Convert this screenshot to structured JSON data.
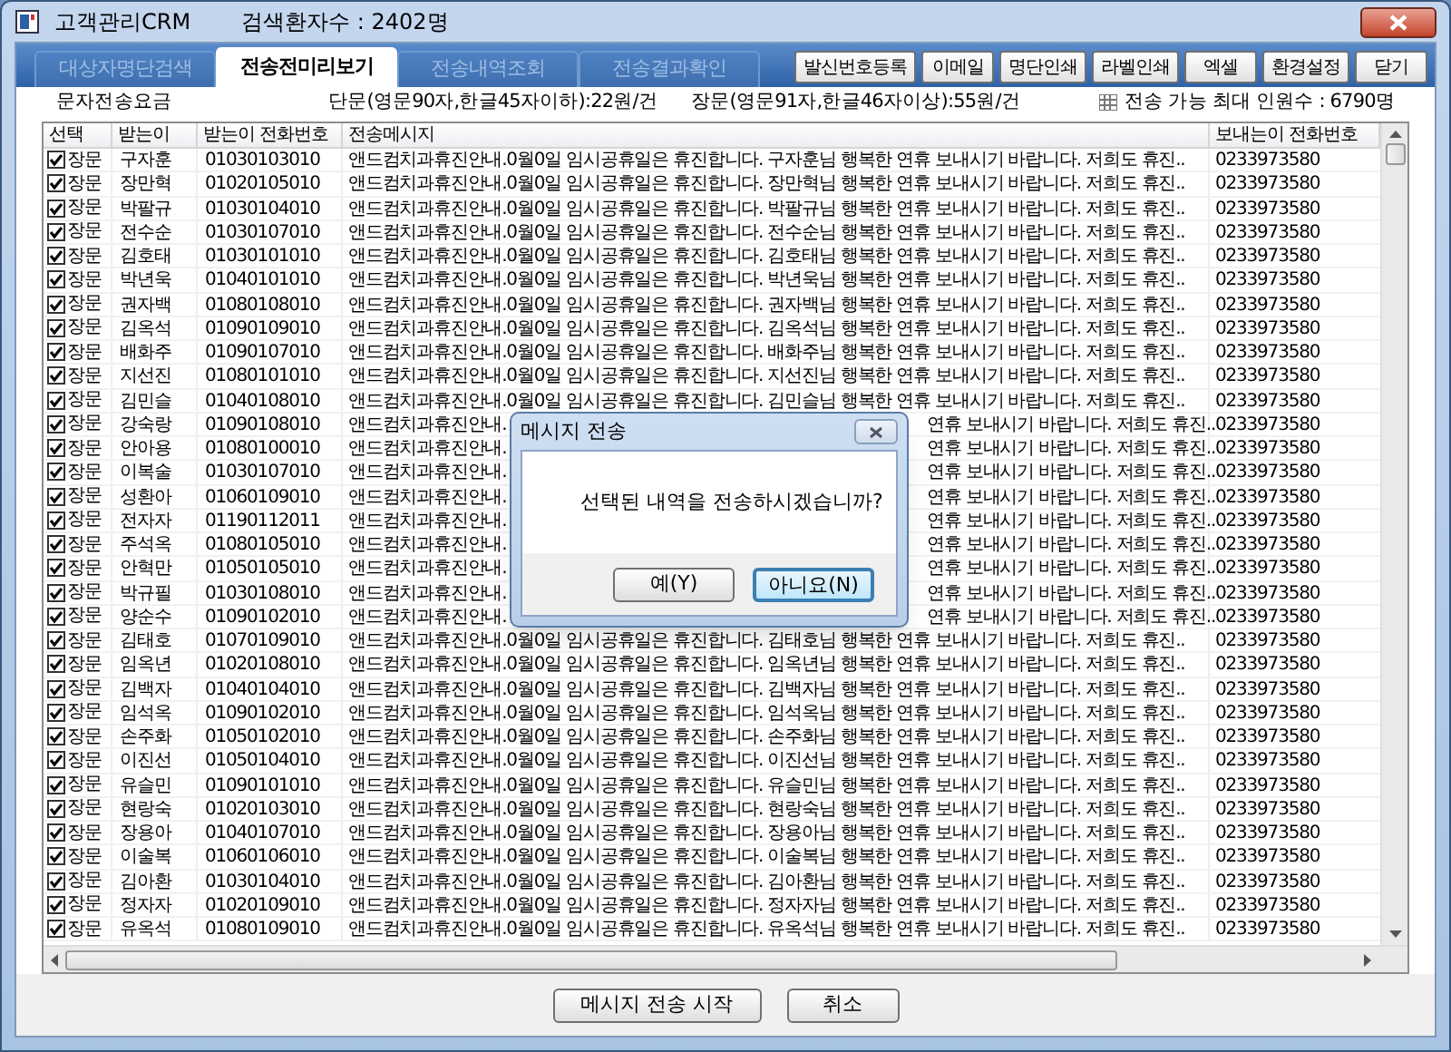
{
  "window": {
    "title": "고객관리CRM",
    "patient_count": "검색환자수 : 2402명"
  },
  "tabs": [
    {
      "label": "대상자명단검색",
      "selected": false
    },
    {
      "label": "전송전미리보기",
      "selected": true
    },
    {
      "label": "전송내역조회",
      "selected": false
    },
    {
      "label": "전송결과확인",
      "selected": false
    }
  ],
  "toolbar": [
    "발신번호등록",
    "이메일",
    "명단인쇄",
    "라벨인쇄",
    "엑셀",
    "환경설정",
    "닫기"
  ],
  "fee_info": {
    "label": "문자전송요금",
    "short": "단문(영문90자,한글45자이하):22원/건",
    "long": "장문(영문91자,한글46자이상):55원/건",
    "max_recipients": "전송 가능 최대 인원수 : 6790명"
  },
  "table": {
    "columns": [
      "선택",
      "받는이",
      "받는이 전화번호",
      "전송메시지",
      "보내는이 전화번호"
    ],
    "rows": [
      {
        "checked": true,
        "type": "장문",
        "name": "구자훈",
        "phone": "01030103010",
        "message": "앤드컴치과휴진안내.0월0일 임시공휴일은 휴진합니다. 구자훈님 행복한 연휴 보내시기 바랍니다. 저희도 휴진..",
        "sender": "0233973580"
      },
      {
        "checked": true,
        "type": "장문",
        "name": "장만혁",
        "phone": "01020105010",
        "message": "앤드컴치과휴진안내.0월0일 임시공휴일은 휴진합니다. 장만혁님 행복한 연휴 보내시기 바랍니다. 저희도 휴진..",
        "sender": "0233973580"
      },
      {
        "checked": true,
        "type": "장문",
        "name": "박팔규",
        "phone": "01030104010",
        "message": "앤드컴치과휴진안내.0월0일 임시공휴일은 휴진합니다. 박팔규님 행복한 연휴 보내시기 바랍니다. 저희도 휴진..",
        "sender": "0233973580"
      },
      {
        "checked": true,
        "type": "장문",
        "name": "전수순",
        "phone": "01030107010",
        "message": "앤드컴치과휴진안내.0월0일 임시공휴일은 휴진합니다. 전수순님 행복한 연휴 보내시기 바랍니다. 저희도 휴진..",
        "sender": "0233973580"
      },
      {
        "checked": true,
        "type": "장문",
        "name": "김호태",
        "phone": "01030101010",
        "message": "앤드컴치과휴진안내.0월0일 임시공휴일은 휴진합니다. 김호태님 행복한 연휴 보내시기 바랍니다. 저희도 휴진..",
        "sender": "0233973580"
      },
      {
        "checked": true,
        "type": "장문",
        "name": "박년욱",
        "phone": "01040101010",
        "message": "앤드컴치과휴진안내.0월0일 임시공휴일은 휴진합니다. 박년욱님 행복한 연휴 보내시기 바랍니다. 저희도 휴진..",
        "sender": "0233973580"
      },
      {
        "checked": true,
        "type": "장문",
        "name": "권자백",
        "phone": "01080108010",
        "message": "앤드컴치과휴진안내.0월0일 임시공휴일은 휴진합니다. 권자백님 행복한 연휴 보내시기 바랍니다. 저희도 휴진..",
        "sender": "0233973580"
      },
      {
        "checked": true,
        "type": "장문",
        "name": "김옥석",
        "phone": "01090109010",
        "message": "앤드컴치과휴진안내.0월0일 임시공휴일은 휴진합니다. 김옥석님 행복한 연휴 보내시기 바랍니다. 저희도 휴진..",
        "sender": "0233973580"
      },
      {
        "checked": true,
        "type": "장문",
        "name": "배화주",
        "phone": "01090107010",
        "message": "앤드컴치과휴진안내.0월0일 임시공휴일은 휴진합니다. 배화주님 행복한 연휴 보내시기 바랍니다. 저희도 휴진..",
        "sender": "0233973580"
      },
      {
        "checked": true,
        "type": "장문",
        "name": "지선진",
        "phone": "01080101010",
        "message": "앤드컴치과휴진안내.0월0일 임시공휴일은 휴진합니다. 지선진님 행복한 연휴 보내시기 바랍니다. 저희도 휴진..",
        "sender": "0233973580"
      },
      {
        "checked": true,
        "type": "장문",
        "name": "김민슬",
        "phone": "01040108010",
        "message": "앤드컴치과휴진안내.0월0일 임시공휴일은 휴진합니다. 김민슬님 행복한 연휴 보내시기 바랍니다. 저희도 휴진..",
        "sender": "0233973580"
      },
      {
        "checked": true,
        "type": "장문",
        "name": "강숙랑",
        "phone": "01090108010",
        "message": "앤드컴치과휴진안내.",
        "message_tail": "연휴 보내시기 바랍니다. 저희도 휴진..",
        "sender": "0233973580"
      },
      {
        "checked": true,
        "type": "장문",
        "name": "안아용",
        "phone": "01080100010",
        "message": "앤드컴치과휴진안내.",
        "message_tail": "연휴 보내시기 바랍니다. 저희도 휴진..",
        "sender": "0233973580"
      },
      {
        "checked": true,
        "type": "장문",
        "name": "이복술",
        "phone": "01030107010",
        "message": "앤드컴치과휴진안내.",
        "message_tail": "연휴 보내시기 바랍니다. 저희도 휴진..",
        "sender": "0233973580"
      },
      {
        "checked": true,
        "type": "장문",
        "name": "성환아",
        "phone": "01060109010",
        "message": "앤드컴치과휴진안내.",
        "message_tail": "연휴 보내시기 바랍니다. 저희도 휴진..",
        "sender": "0233973580"
      },
      {
        "checked": true,
        "type": "장문",
        "name": "전자자",
        "phone": "01190112011",
        "message": "앤드컴치과휴진안내.",
        "message_tail": "연휴 보내시기 바랍니다. 저희도 휴진..",
        "sender": "0233973580"
      },
      {
        "checked": true,
        "type": "장문",
        "name": "주석옥",
        "phone": "01080105010",
        "message": "앤드컴치과휴진안내.",
        "message_tail": "연휴 보내시기 바랍니다. 저희도 휴진..",
        "sender": "0233973580"
      },
      {
        "checked": true,
        "type": "장문",
        "name": "안혁만",
        "phone": "01050105010",
        "message": "앤드컴치과휴진안내.",
        "message_tail": "연휴 보내시기 바랍니다. 저희도 휴진..",
        "sender": "0233973580"
      },
      {
        "checked": true,
        "type": "장문",
        "name": "박규필",
        "phone": "01030108010",
        "message": "앤드컴치과휴진안내.",
        "message_tail": "연휴 보내시기 바랍니다. 저희도 휴진..",
        "sender": "0233973580"
      },
      {
        "checked": true,
        "type": "장문",
        "name": "양순수",
        "phone": "01090102010",
        "message": "앤드컴치과휴진안내.",
        "message_tail": "연휴 보내시기 바랍니다. 저희도 휴진..",
        "sender": "0233973580"
      },
      {
        "checked": true,
        "type": "장문",
        "name": "김태호",
        "phone": "01070109010",
        "message": "앤드컴치과휴진안내.0월0일 임시공휴일은 휴진합니다. 김태호님 행복한 연휴 보내시기 바랍니다. 저희도 휴진..",
        "sender": "0233973580"
      },
      {
        "checked": true,
        "type": "장문",
        "name": "임옥년",
        "phone": "01020108010",
        "message": "앤드컴치과휴진안내.0월0일 임시공휴일은 휴진합니다. 임옥년님 행복한 연휴 보내시기 바랍니다. 저희도 휴진..",
        "sender": "0233973580"
      },
      {
        "checked": true,
        "type": "장문",
        "name": "김백자",
        "phone": "01040104010",
        "message": "앤드컴치과휴진안내.0월0일 임시공휴일은 휴진합니다. 김백자님 행복한 연휴 보내시기 바랍니다. 저희도 휴진..",
        "sender": "0233973580"
      },
      {
        "checked": true,
        "type": "장문",
        "name": "임석옥",
        "phone": "01090102010",
        "message": "앤드컴치과휴진안내.0월0일 임시공휴일은 휴진합니다. 임석옥님 행복한 연휴 보내시기 바랍니다. 저희도 휴진..",
        "sender": "0233973580"
      },
      {
        "checked": true,
        "type": "장문",
        "name": "손주화",
        "phone": "01050102010",
        "message": "앤드컴치과휴진안내.0월0일 임시공휴일은 휴진합니다. 손주화님 행복한 연휴 보내시기 바랍니다. 저희도 휴진..",
        "sender": "0233973580"
      },
      {
        "checked": true,
        "type": "장문",
        "name": "이진선",
        "phone": "01050104010",
        "message": "앤드컴치과휴진안내.0월0일 임시공휴일은 휴진합니다. 이진선님 행복한 연휴 보내시기 바랍니다. 저희도 휴진..",
        "sender": "0233973580"
      },
      {
        "checked": true,
        "type": "장문",
        "name": "유슬민",
        "phone": "01090101010",
        "message": "앤드컴치과휴진안내.0월0일 임시공휴일은 휴진합니다. 유슬민님 행복한 연휴 보내시기 바랍니다. 저희도 휴진..",
        "sender": "0233973580"
      },
      {
        "checked": true,
        "type": "장문",
        "name": "현랑숙",
        "phone": "01020103010",
        "message": "앤드컴치과휴진안내.0월0일 임시공휴일은 휴진합니다. 현랑숙님 행복한 연휴 보내시기 바랍니다. 저희도 휴진..",
        "sender": "0233973580"
      },
      {
        "checked": true,
        "type": "장문",
        "name": "장용아",
        "phone": "01040107010",
        "message": "앤드컴치과휴진안내.0월0일 임시공휴일은 휴진합니다. 장용아님 행복한 연휴 보내시기 바랍니다. 저희도 휴진..",
        "sender": "0233973580"
      },
      {
        "checked": true,
        "type": "장문",
        "name": "이술복",
        "phone": "01060106010",
        "message": "앤드컴치과휴진안내.0월0일 임시공휴일은 휴진합니다. 이술복님 행복한 연휴 보내시기 바랍니다. 저희도 휴진..",
        "sender": "0233973580"
      },
      {
        "checked": true,
        "type": "장문",
        "name": "김아환",
        "phone": "01030104010",
        "message": "앤드컴치과휴진안내.0월0일 임시공휴일은 휴진합니다. 김아환님 행복한 연휴 보내시기 바랍니다. 저희도 휴진..",
        "sender": "0233973580"
      },
      {
        "checked": true,
        "type": "장문",
        "name": "정자자",
        "phone": "01020109010",
        "message": "앤드컴치과휴진안내.0월0일 임시공휴일은 휴진합니다. 정자자님 행복한 연휴 보내시기 바랍니다. 저희도 휴진..",
        "sender": "0233973580"
      },
      {
        "checked": true,
        "type": "장문",
        "name": "유옥석",
        "phone": "01080109010",
        "message": "앤드컴치과휴진안내.0월0일 임시공휴일은 휴진합니다. 유옥석님 행복한 연휴 보내시기 바랍니다. 저희도 휴진..",
        "sender": "0233973580"
      }
    ]
  },
  "footer_buttons": [
    "메시지 전송 시작",
    "취소"
  ],
  "dialog": {
    "title": "메시지 전송",
    "message": "선택된 내역을 전송하시겠습니까?",
    "buttons": [
      {
        "label": "예(Y)",
        "selected": false
      },
      {
        "label": "아니요(N)",
        "selected": true
      }
    ]
  }
}
